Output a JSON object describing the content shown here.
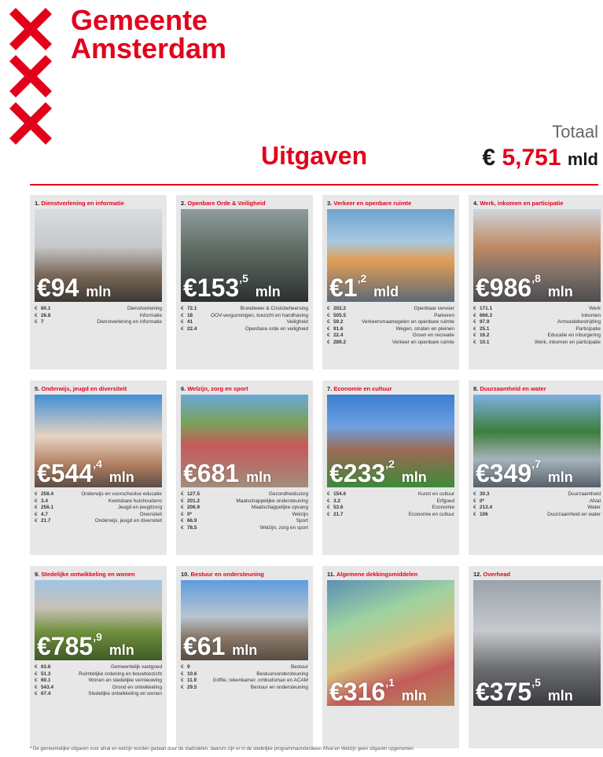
{
  "brand": {
    "line1": "Gemeente",
    "line2": "Amsterdam"
  },
  "heading": "Uitgaven",
  "totaal": {
    "label": "Totaal",
    "prefix": "€",
    "value": "5,751",
    "unit": "mld"
  },
  "cards": [
    {
      "idx": "1.",
      "title": "Dienstverlening en informatie",
      "big": "€94",
      "sup": "",
      "unit": "mln",
      "items": [
        {
          "amt": "60.1",
          "label": "Dienstverlening"
        },
        {
          "amt": "26.8",
          "label": "Informatie"
        },
        {
          "amt": "7",
          "label": "Dienstverlening en informatie"
        }
      ]
    },
    {
      "idx": "2.",
      "title": "Openbare Orde & Veiligheid",
      "big": "€153",
      "sup": ",5",
      "unit": "mln",
      "items": [
        {
          "amt": "72.1",
          "label": "Brandweer & Crisisbeheersing"
        },
        {
          "amt": "18",
          "label": "OOV-vergunningen, toezicht en handhaving"
        },
        {
          "amt": "41",
          "label": "Veiligheid"
        },
        {
          "amt": "22.4",
          "label": "Openbare orde en veiligheid"
        }
      ]
    },
    {
      "idx": "3.",
      "title": "Verkeer en openbare ruimte",
      "big": "€1",
      "sup": ",2",
      "unit": "mld",
      "items": [
        {
          "amt": "202.2",
          "label": "Openbaar vervoer"
        },
        {
          "amt": "505.5",
          "label": "Parkeren"
        },
        {
          "amt": "59.2",
          "label": "Verkeersmaatregelen en openbare ruimte"
        },
        {
          "amt": "91.6",
          "label": "Wegen, straten en pleinen"
        },
        {
          "amt": "22.4",
          "label": "Groen en recreatie"
        },
        {
          "amt": "289.2",
          "label": "Verkeer en openbare ruimte"
        }
      ]
    },
    {
      "idx": "4.",
      "title": "Werk, inkomen en participatie",
      "big": "€986",
      "sup": ",8",
      "unit": "mln",
      "items": [
        {
          "amt": "171.1",
          "label": "Werk"
        },
        {
          "amt": "666.3",
          "label": "Inkomen"
        },
        {
          "amt": "97.9",
          "label": "Armoedebestrijding"
        },
        {
          "amt": "25.1",
          "label": "Participatie"
        },
        {
          "amt": "16.2",
          "label": "Educatie en inburgering"
        },
        {
          "amt": "10.1",
          "label": "Werk, inkomen en participatie"
        }
      ]
    },
    {
      "idx": "5.",
      "title": "Onderwijs, jeugd en diversiteit",
      "big": "€544",
      "sup": ",4",
      "unit": "mln",
      "items": [
        {
          "amt": "258.4",
          "label": "Onderwijs en voorschoolse educatie"
        },
        {
          "amt": "3.4",
          "label": "Kwetsbare huishoudens"
        },
        {
          "amt": "256.1",
          "label": "Jeugd en jeugdzorg"
        },
        {
          "amt": "4.7",
          "label": "Diversiteit"
        },
        {
          "amt": "21.7",
          "label": "Onderwijs, jeugd en diversiteit"
        }
      ]
    },
    {
      "idx": "6.",
      "title": "Welzijn, zorg en sport",
      "big": "€681",
      "sup": "",
      "unit": "mln",
      "items": [
        {
          "amt": "127.5",
          "label": "Gezondheidszorg"
        },
        {
          "amt": "201.2",
          "label": "Maatschappelijke ondersteuning"
        },
        {
          "amt": "206.9",
          "label": "Maatschappelijke opvang"
        },
        {
          "amt": "0*",
          "label": "Welzijn"
        },
        {
          "amt": "66.9",
          "label": "Sport"
        },
        {
          "amt": "78.5",
          "label": "Welzijn, zorg en sport"
        }
      ]
    },
    {
      "idx": "7.",
      "title": "Economie en cultuur",
      "big": "€233",
      "sup": ",2",
      "unit": "mln",
      "items": [
        {
          "amt": "154.6",
          "label": "Kunst en cultuur"
        },
        {
          "amt": "3.2",
          "label": "Erfgoed"
        },
        {
          "amt": "53.6",
          "label": "Economie"
        },
        {
          "amt": "21.7",
          "label": "Economie en cultuur"
        }
      ]
    },
    {
      "idx": "8.",
      "title": "Duurzaamheid en water",
      "big": "€349",
      "sup": ",7",
      "unit": "mln",
      "items": [
        {
          "amt": "30.3",
          "label": "Duurzaamheid"
        },
        {
          "amt": "0*",
          "label": "Afval"
        },
        {
          "amt": "213.4",
          "label": "Water"
        },
        {
          "amt": "106",
          "label": "Duurzaamheid en water"
        }
      ]
    },
    {
      "idx": "9.",
      "title": "Stedelijke ontwikkeling en wonen",
      "big": "€785",
      "sup": ",9",
      "unit": "mln",
      "items": [
        {
          "amt": "63.6",
          "label": "Gemeentelijk vastgoed"
        },
        {
          "amt": "51.3",
          "label": "Ruimtelijke ordening en bouwtoezicht"
        },
        {
          "amt": "60.1",
          "label": "Wonen en stedelijke vernieuwing"
        },
        {
          "amt": "543.4",
          "label": "Grond en ontwikkeling"
        },
        {
          "amt": "67.4",
          "label": "Stedelijke ontwikkeling en wonen"
        }
      ]
    },
    {
      "idx": "10.",
      "title": "Bestuur en ondersteuning",
      "big": "€61",
      "sup": "",
      "unit": "mln",
      "items": [
        {
          "amt": "9",
          "label": "Bestuur"
        },
        {
          "amt": "10.6",
          "label": "Bestuursondersteuning"
        },
        {
          "amt": "11.9",
          "label": "Griffie, rekenkamer, ombudsman en ACAM"
        },
        {
          "amt": "29.5",
          "label": "Bestuur en ondersteuning"
        }
      ]
    },
    {
      "idx": "11.",
      "title": "Algemene dekkingsmiddelen",
      "big": "€316",
      "sup": ",1",
      "unit": "mln",
      "items": []
    },
    {
      "idx": "12.",
      "title": "Overhead",
      "big": "€375",
      "sup": ",5",
      "unit": "mln",
      "items": []
    }
  ],
  "footnote": "* De gemeentelijke uitgaven voor afval en welzijn worden gedaan door de stadsdelen, daarom zijn er in de stedelijke programmaonderdelen Afval en Welzijn geen uitgaven opgenomen"
}
